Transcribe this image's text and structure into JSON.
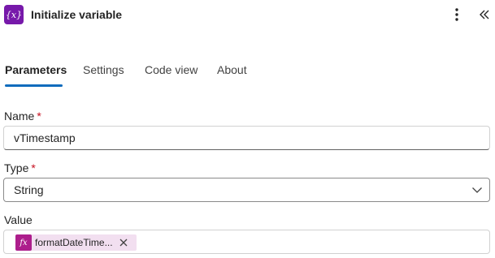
{
  "header": {
    "icon_glyph": "{x}",
    "title": "Initialize variable",
    "more_icon": "more-vertical-icon",
    "collapse_icon": "double-chevron-left-icon",
    "icon_color": "#7719aa"
  },
  "tabs": [
    {
      "label": "Parameters",
      "active": true
    },
    {
      "label": "Settings",
      "active": false
    },
    {
      "label": "Code view",
      "active": false
    },
    {
      "label": "About",
      "active": false
    }
  ],
  "fields": {
    "name": {
      "label": "Name",
      "required_mark": "*",
      "value": "vTimestamp"
    },
    "type": {
      "label": "Type",
      "required_mark": "*",
      "value": "String"
    },
    "value": {
      "label": "Value",
      "token": {
        "icon_glyph": "fx",
        "text": "formatDateTime...",
        "color": "#ad1e8c"
      }
    }
  },
  "accent_color": "#0f6cbd",
  "required_color": "#c50f1f"
}
